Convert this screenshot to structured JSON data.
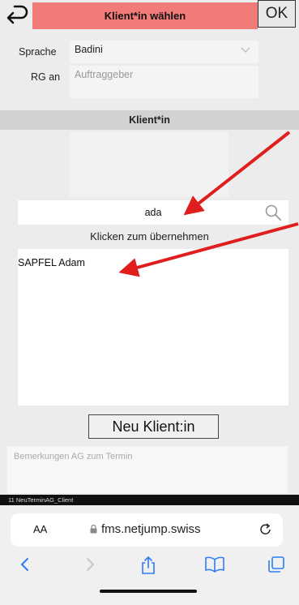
{
  "header": {
    "title": "Klient*in wählen",
    "ok_label": "OK"
  },
  "form": {
    "sprache_label": "Sprache",
    "sprache_value": "Badini",
    "rg_label": "RG an",
    "rg_placeholder": "Auftraggeber"
  },
  "section": {
    "title": "Klient*in"
  },
  "search": {
    "value": "ada"
  },
  "hint": "Klicken zum übernehmen",
  "results": [
    "SAPFEL Adam"
  ],
  "new_client_label": "Neu Klient:in",
  "notes_placeholder": "Bemerkungen AG zum Termin",
  "status_strip": "11  NeuTerminAG_Client",
  "browser": {
    "aa_label": "AA",
    "url": "fms.netjump.swiss"
  },
  "colors": {
    "title_bar": "#f07b78",
    "annotation_arrow": "#e01e1e"
  }
}
